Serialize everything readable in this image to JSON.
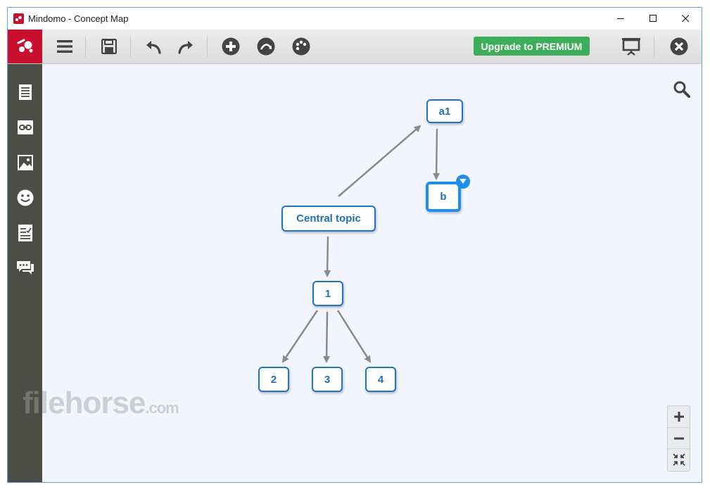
{
  "window": {
    "title": "Mindomo - Concept Map"
  },
  "toolbar": {
    "menu_icon": "hamburger-icon",
    "save_icon": "floppy-disk-icon",
    "undo_icon": "undo-arrow-icon",
    "redo_icon": "redo-arrow-icon",
    "add_icon": "plus-circle-icon",
    "relationship_icon": "relationship-curve-icon",
    "theme_icon": "palette-icon",
    "premium_label": "Upgrade to PREMIUM",
    "presentation_icon": "presentation-board-icon",
    "close_icon": "close-circle-icon",
    "premium_color": "#3fae5a"
  },
  "sidebar": {
    "items": [
      {
        "name": "notes",
        "icon": "notes-icon"
      },
      {
        "name": "link",
        "icon": "link-icon"
      },
      {
        "name": "image",
        "icon": "image-icon"
      },
      {
        "name": "icons",
        "icon": "smiley-icon"
      },
      {
        "name": "tasks",
        "icon": "checklist-icon"
      },
      {
        "name": "comments",
        "icon": "comments-icon"
      }
    ]
  },
  "map": {
    "nodes": {
      "central": "Central topic",
      "a1": "a1",
      "b": "b",
      "n1": "1",
      "n2": "2",
      "n3": "3",
      "n4": "4"
    },
    "selected_node": "b",
    "node_border_color": "#1f73c9",
    "selected_color": "#1e8ff0",
    "connector_color": "#8a8a8a"
  },
  "zoom": {
    "in_label": "+",
    "out_label": "−"
  },
  "watermark": {
    "text": "filehorse",
    "suffix": ".com"
  }
}
